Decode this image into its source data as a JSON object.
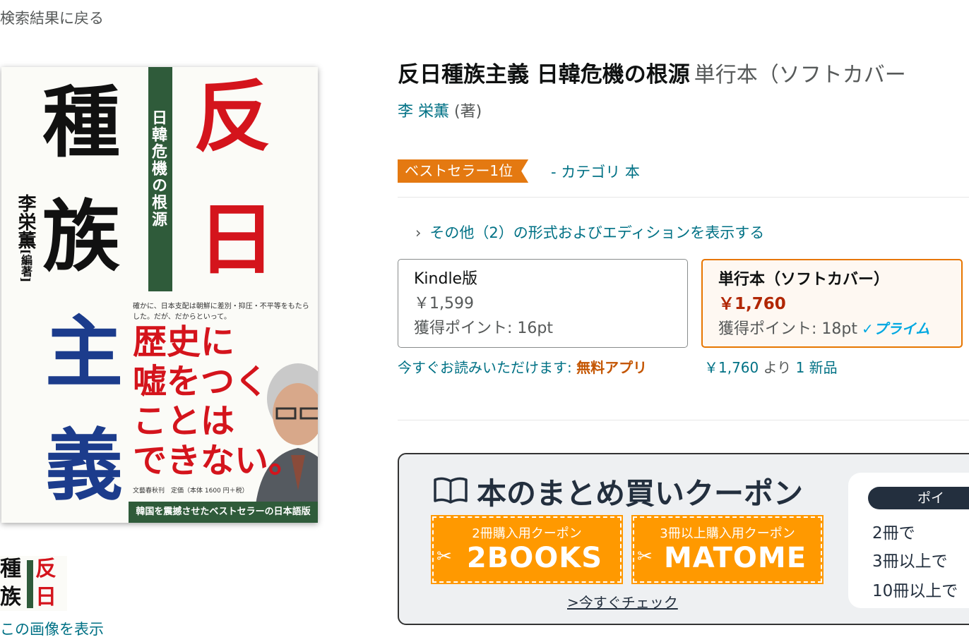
{
  "back_link": "検索結果に戻る",
  "cover": {
    "title_chars": [
      "反",
      "日",
      "種",
      "族",
      "主",
      "義"
    ],
    "subtitle_vertical": "日韓危機の根源",
    "author_vertical": "李栄薫",
    "author_role_vertical": "[編著]",
    "blurb": "確かに、日本支配は朝鮮に差別・抑圧・不平等をもたらした。だが、だからといって。",
    "headline_lines": [
      "歴史に",
      "嘘をつく",
      "ことは",
      "できない。"
    ],
    "publisher": "文藝春秋刊　定価（本体 1600 円＋税）",
    "bottom_bar": "韓国を震撼させたベストセラーの日本語版"
  },
  "thumbnail": {
    "chars": [
      "種",
      "反",
      "族",
      "日"
    ]
  },
  "show_images_link": "この画像を表示",
  "product": {
    "title": "反日種族主義 日韓危機の根源",
    "format_subtitle": "単行本（ソフトカバー",
    "author": "李 栄薫",
    "author_role": "(著)",
    "badge": "ベストセラー1位",
    "category": "- カテゴリ 本",
    "other_formats": "その他（2）の形式およびエディションを表示する"
  },
  "formats": {
    "kindle": {
      "name": "Kindle版",
      "price": "￥1,599",
      "points": "獲得ポイント: 16pt",
      "note_prefix": "今すぐお読みいただけます: ",
      "note_app": "無料アプリ"
    },
    "paperback": {
      "name": "単行本（ソフトカバー）",
      "price": "￥1,760",
      "points": "獲得ポイント: 18pt",
      "prime": "✓プライム",
      "offer_price": "￥1,760",
      "offer_from": " より ",
      "offer_count": "1 新品"
    }
  },
  "coupon": {
    "title": "本のまとめ買いクーポン",
    "ticket1_label": "2冊購入用クーポン",
    "ticket1_code": "2BOOKS",
    "ticket2_label": "3冊以上購入用クーポン",
    "ticket2_code": "MATOME",
    "check_link": ">今すぐチェック",
    "points_header": "ポイ",
    "points_rows": [
      "2冊で",
      "3冊以上で",
      "10冊以上で"
    ]
  },
  "colors": {
    "link": "#007185",
    "badge": "#e47911",
    "price": "#b12704",
    "selected_border": "#e77600",
    "coupon_orange": "#ff9900",
    "cover_red": "#d4141c",
    "cover_blue": "#1c3c8c",
    "cover_green": "#2f5b3a"
  }
}
